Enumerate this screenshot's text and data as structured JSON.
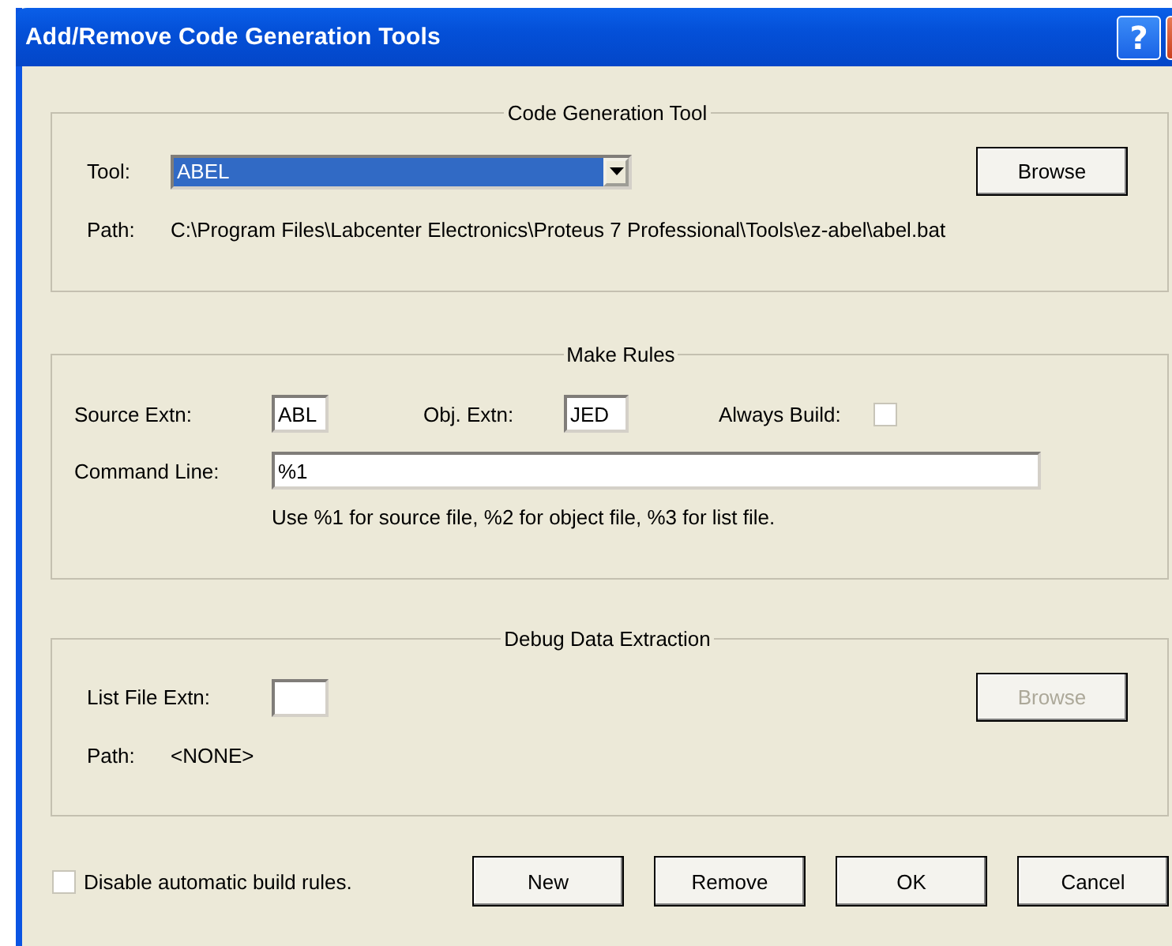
{
  "window": {
    "title": "Add/Remove Code Generation Tools",
    "help_button": "?"
  },
  "code_generation_tool": {
    "title": "Code Generation Tool",
    "tool_label": "Tool:",
    "tool_value": "ABEL",
    "tool_selected": true,
    "browse": {
      "label": "Browse",
      "disabled": false
    },
    "path_label": "Path:",
    "path_value": "C:\\Program Files\\Labcenter Electronics\\Proteus 7 Professional\\Tools\\ez-abel\\abel.bat"
  },
  "make_rules": {
    "title": "Make Rules",
    "source_label": "Source Extn:",
    "source_value": "ABL",
    "obj_label": "Obj. Extn:",
    "obj_value": "JED",
    "always_build_label": "Always Build:",
    "always_build_checked": false,
    "command_label": "Command Line:",
    "command_value": "%1",
    "hint": "Use %1 for source file, %2 for object file, %3 for list file."
  },
  "debug_data_extraction": {
    "title": "Debug Data Extraction",
    "list_label": "List File Extn:",
    "browse": {
      "label": "Browse",
      "disabled": true
    },
    "path_label": "Path:",
    "path_value": "<NONE>"
  },
  "disable_rules": {
    "label": "Disable automatic build rules.",
    "checked": false
  },
  "buttons": [
    "New",
    "Remove",
    "OK",
    "Cancel"
  ]
}
